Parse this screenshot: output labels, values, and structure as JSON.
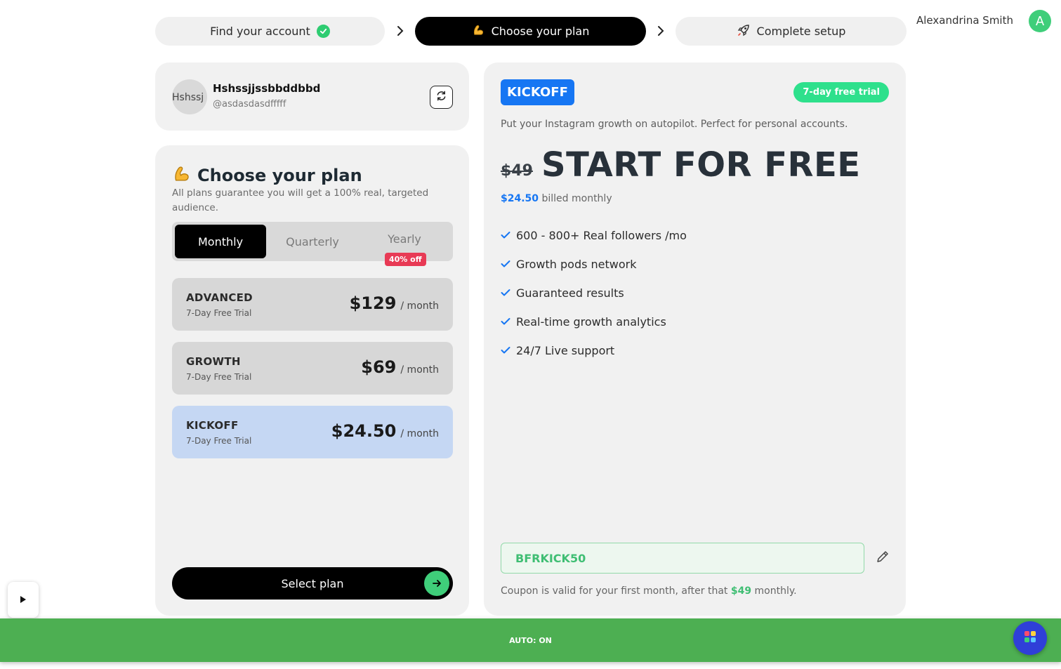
{
  "stepper": {
    "steps": [
      {
        "label": "Find your account",
        "state": "done"
      },
      {
        "label": "Choose your plan",
        "state": "active"
      },
      {
        "label": "Complete setup",
        "state": "pending"
      }
    ]
  },
  "user": {
    "name": "Alexandrina Smith",
    "initial": "A"
  },
  "account": {
    "avatar_alt": "Hshssj",
    "name": "Hshssjjssbbddbbd",
    "handle": "@asdasdasdfffff"
  },
  "plans": {
    "title": "Choose your plan",
    "subtitle": "All plans guarantee you will get a 100% real, targeted audience.",
    "billing_options": [
      "Monthly",
      "Quarterly",
      "Yearly"
    ],
    "billing_selected": "Monthly",
    "discount_badge": "40% off",
    "items": [
      {
        "name": "ADVANCED",
        "trial": "7-Day Free Trial",
        "price": "$129",
        "unit": "/ month"
      },
      {
        "name": "GROWTH",
        "trial": "7-Day Free Trial",
        "price": "$69",
        "unit": "/ month"
      },
      {
        "name": "KICKOFF",
        "trial": "7-Day Free Trial",
        "price": "$24.50",
        "unit": "/ month"
      }
    ],
    "selected": "KICKOFF",
    "select_label": "Select plan"
  },
  "detail": {
    "tier": "KICKOFF",
    "trial_pill": "7-day free trial",
    "description": "Put your Instagram growth on autopilot. Perfect for personal accounts.",
    "old_price": "$49",
    "headline": "START FOR FREE",
    "billed_amount": "$24.50",
    "billed_text": "billed monthly",
    "features": [
      "600 - 800+ Real followers /mo",
      "Growth pods network",
      "Guaranteed results",
      "Real-time growth analytics",
      "24/7 Live support"
    ],
    "coupon_code": "BFRKICK50",
    "coupon_note_prefix": "Coupon is valid for your first month, after that",
    "coupon_note_amount": "$49",
    "coupon_note_suffix": "monthly."
  },
  "auto_bar": {
    "label": "AUTO: ON"
  },
  "colors": {
    "accent_blue": "#1676f3",
    "accent_green": "#3fce7a",
    "auto_bar": "#4daf52",
    "badge_red": "#e83a55"
  },
  "icons": [
    "check-circle-icon",
    "chevron-right-icon",
    "flexed-arm-icon",
    "rocket-icon",
    "refresh-icon",
    "check-icon",
    "arrow-right-icon",
    "pencil-icon",
    "play-icon",
    "chat-icon"
  ]
}
